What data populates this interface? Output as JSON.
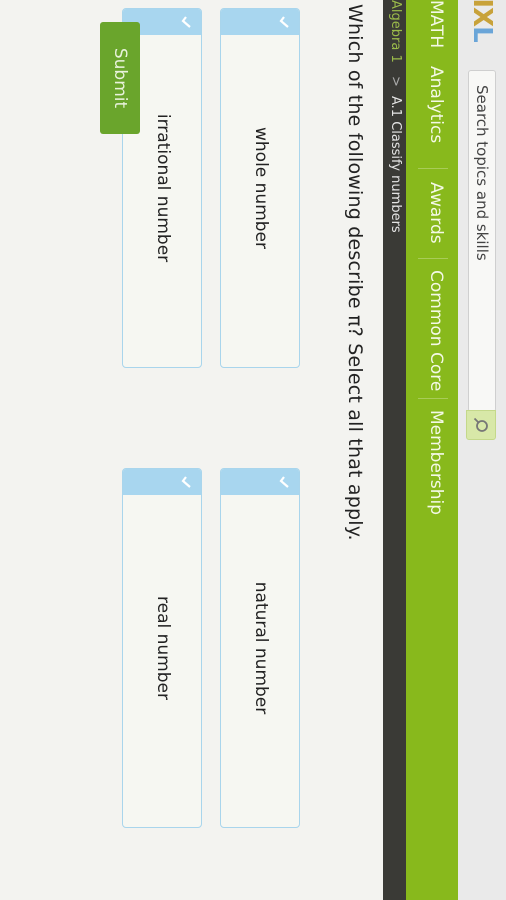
{
  "header": {
    "logo": {
      "ix": "IX",
      "l": "L"
    },
    "search": {
      "placeholder": "Search topics and skills"
    }
  },
  "nav": {
    "items": [
      "MATH",
      "Analytics",
      "Awards",
      "Common Core",
      "Membership"
    ]
  },
  "breadcrumb": {
    "subject": "Algebra 1",
    "arrow": ">",
    "skill": "A.1 Classify numbers"
  },
  "question": {
    "text": "Which of the following describe π? Select all that apply."
  },
  "answers": [
    {
      "label": "whole number"
    },
    {
      "label": "natural number"
    },
    {
      "label": "irrational number"
    },
    {
      "label": "real number"
    }
  ],
  "submit": {
    "label": "Submit"
  },
  "colors": {
    "nav_green": "#88b91c",
    "tile_border": "#a9d5ec",
    "check_blue": "#a8d6ef",
    "submit_green": "#6aa52c"
  },
  "icons": {
    "search": "search-icon",
    "check": "check-icon"
  }
}
